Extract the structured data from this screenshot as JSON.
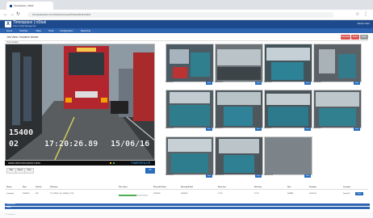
{
  "browser": {
    "tab_title": "Timespace | nStuk",
    "url": "timespacestuk.com/VideoDownload/Video#1111111111"
  },
  "app": {
    "title": "Timespace | nStuk",
    "subtitle": "Video & Data Management",
    "user": "Admin User",
    "menu": [
      "Home",
      "Vehicles",
      "Video",
      "Tools",
      "Configuration",
      "Reporting"
    ]
  },
  "page": {
    "title": "Job View / Incident Viewer",
    "subnav": "Video   Details",
    "buttons": [
      "Download",
      "Share",
      "Close"
    ]
  },
  "player": {
    "overlay_route": "15400",
    "overlay_cam": "02",
    "overlay_time": "17:20:26.89",
    "overlay_date": "15/06/16",
    "status": "0000N,00W 0150,0000N   0 MPH",
    "brand": "TIMESPACE",
    "controls": [
      "Play",
      "Pause",
      "Stop"
    ],
    "confirm_label": "OK"
  },
  "thumbnails": [
    {
      "label": "Camera 1",
      "btn": "View"
    },
    {
      "label": "Camera 2",
      "btn": "View"
    },
    {
      "label": "Camera 3",
      "btn": "View"
    },
    {
      "label": "Camera 4",
      "btn": "View"
    },
    {
      "label": "Camera 5",
      "btn": "View"
    },
    {
      "label": "Camera 6",
      "btn": "View"
    },
    {
      "label": "Camera 7",
      "btn": "View"
    },
    {
      "label": "Camera 8",
      "btn": "View"
    },
    {
      "label": "Camera 9",
      "btn": "View"
    },
    {
      "label": "Camera 10",
      "btn": "View"
    },
    {
      "label": "Camera 11",
      "btn": "View"
    }
  ],
  "table": {
    "headers": [
      "Status",
      "Date",
      "Vehicle",
      "Filename",
      "File status",
      "Recorded Start",
      "Recorded End",
      "Start time",
      "End time",
      "Size",
      "Duration",
      "Location"
    ],
    "row": [
      "Complete",
      "15/06/16",
      "402",
      "TS_VIDEO_02_150616_1720",
      "",
      "15/06/16",
      "15/06/16",
      "17:20",
      "17:25",
      "340MB",
      "00:05:00",
      "Depot A"
    ],
    "progress": 0.6,
    "action_label": "Open"
  },
  "footer_bars": [
    "Downloads",
    "Notes"
  ],
  "footer_text": "© Timespace"
}
